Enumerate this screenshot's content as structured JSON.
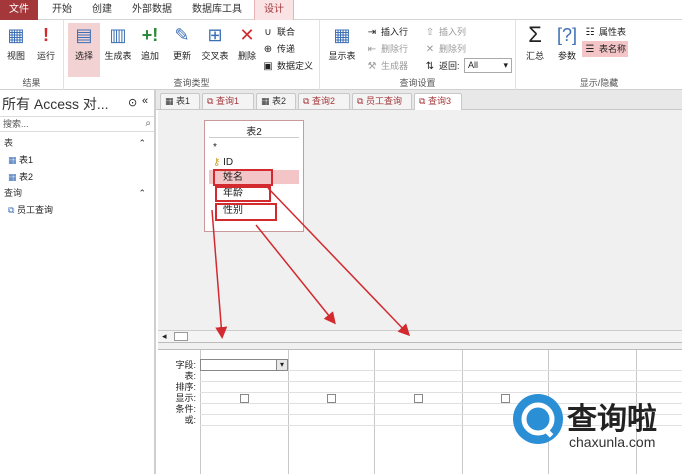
{
  "ribbon_tabs": [
    "文件",
    "开始",
    "创建",
    "外部数据",
    "数据库工具",
    "设计"
  ],
  "groups": {
    "results": {
      "label": "结果",
      "view": "视图",
      "run": "运行"
    },
    "query_type": {
      "label": "查询类型",
      "select": "选择",
      "make_table": "生成表",
      "append": "追加",
      "update": "更新",
      "crosstab": "交叉表",
      "delete": "删除",
      "union": "联合",
      "pass_through": "传递",
      "data_definition": "数据定义"
    },
    "query_setup": {
      "label": "查询设置",
      "show_table": "显示表",
      "insert_rows": "插入行",
      "delete_rows": "删除行",
      "builder": "生成器",
      "insert_cols": "插入列",
      "delete_cols": "删除列",
      "return_label": "返回:",
      "return_value": "All"
    },
    "show_hide": {
      "label": "显示/隐藏",
      "totals": "汇总",
      "params": "参数",
      "property_sheet": "属性表",
      "table_names": "表名称"
    }
  },
  "nav": {
    "header": "所有 Access 对...",
    "search_placeholder": "搜索...",
    "cat_tables": "表",
    "tables": [
      "表1",
      "表2"
    ],
    "cat_queries": "查询",
    "queries": [
      "员工查询"
    ]
  },
  "doc_tabs": [
    "表1",
    "查询1",
    "表2",
    "查询2",
    "员工查询",
    "查询3"
  ],
  "table_box": {
    "title": "表2",
    "star": "*",
    "fields": [
      "ID",
      "姓名",
      "年龄",
      "性别"
    ]
  },
  "grid": {
    "row_labels": [
      "字段:",
      "表:",
      "排序:",
      "显示:",
      "条件:",
      "或:"
    ]
  },
  "logo": {
    "cn": "查询啦",
    "url": "chaxunla.com"
  },
  "colors": {
    "accent": "#a4373a",
    "highlight": "#d22a2f"
  }
}
